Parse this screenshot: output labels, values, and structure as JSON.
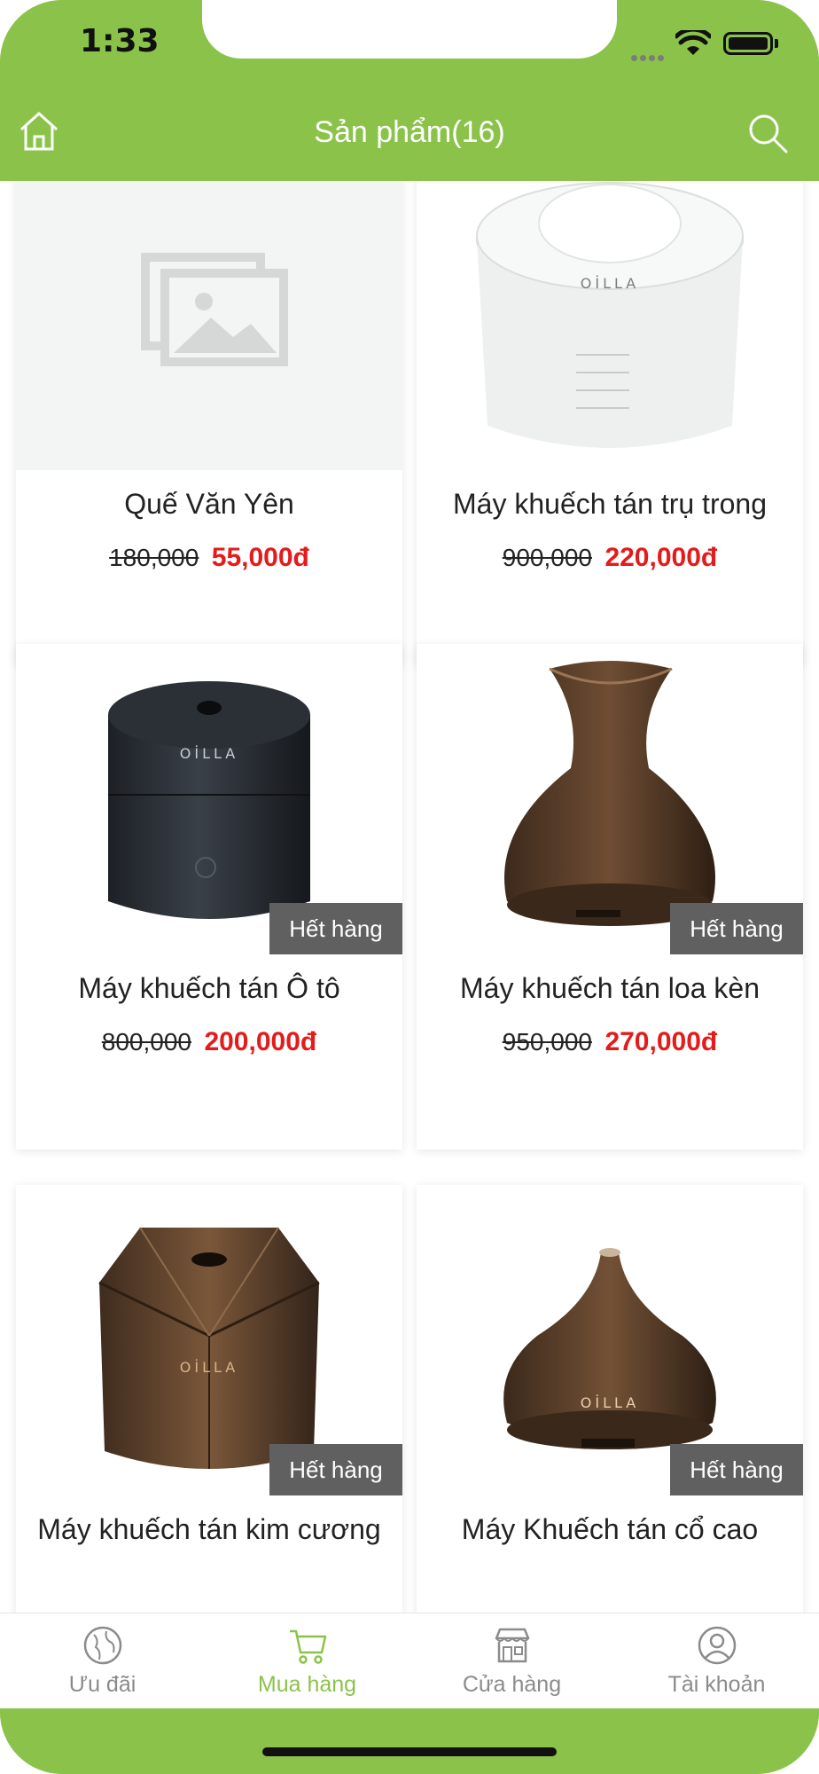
{
  "status_bar": {
    "time": "1:33"
  },
  "header": {
    "title": "Sản phẩm(16)"
  },
  "products": [
    {
      "name": "Quế Văn Yên",
      "old_price": "180,000",
      "new_price": "55,000đ",
      "badge": "",
      "image": "placeholder-image-icon"
    },
    {
      "name": "Máy khuếch tán trụ trong",
      "old_price": "900,000",
      "new_price": "220,000đ",
      "badge": "",
      "image": "white-diffuser"
    },
    {
      "name": "Máy khuếch tán Ô tô",
      "old_price": "800,000",
      "new_price": "200,000đ",
      "badge": "Hết hàng",
      "image": "black-car-diffuser"
    },
    {
      "name": "Máy khuếch tán loa kèn",
      "old_price": "950,000",
      "new_price": "270,000đ",
      "badge": "Hết hàng",
      "image": "wood-vase-diffuser"
    },
    {
      "name": "Máy khuếch tán kim cương",
      "old_price": "",
      "new_price": "",
      "badge": "Hết hàng",
      "image": "wood-diamond-diffuser"
    },
    {
      "name": "Máy Khuếch tán cổ cao",
      "old_price": "",
      "new_price": "",
      "badge": "Hết hàng",
      "image": "wood-onion-diffuser"
    }
  ],
  "brand_label": "OİLLA",
  "tabs": [
    {
      "label": "Ưu đãi",
      "icon": "globe-icon",
      "active": false
    },
    {
      "label": "Mua hàng",
      "icon": "cart-icon",
      "active": true
    },
    {
      "label": "Cửa hàng",
      "icon": "store-icon",
      "active": false
    },
    {
      "label": "Tài khoản",
      "icon": "user-icon",
      "active": false
    }
  ],
  "colors": {
    "primary": "#8bc34a",
    "price_sale": "#e31b1b",
    "badge_bg": "#606060",
    "tab_inactive": "#8b8b8b"
  }
}
